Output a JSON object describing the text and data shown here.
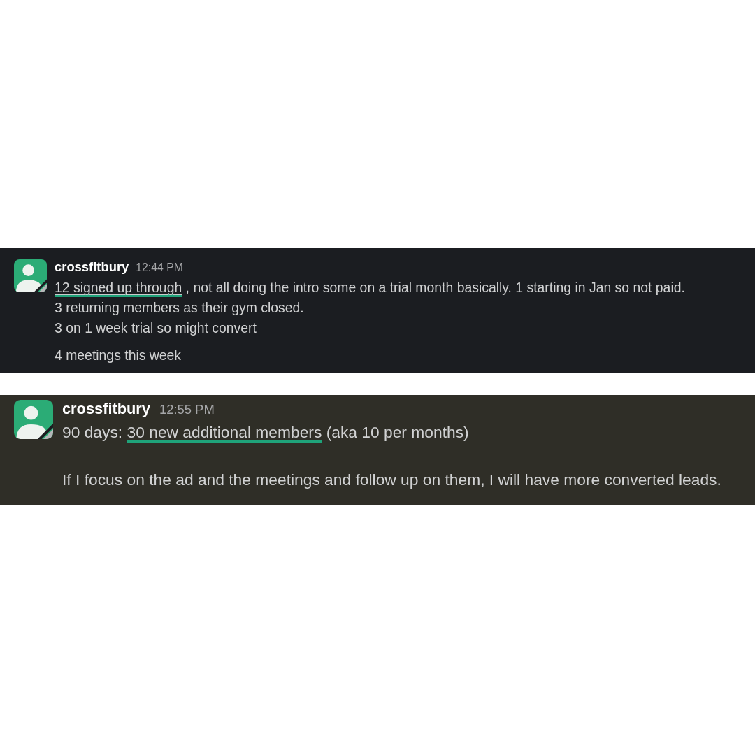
{
  "messages": [
    {
      "author": "crossfitbury",
      "time": "12:44 PM",
      "paragraphs": [
        [
          [
            {
              "text": "12 signed up through",
              "highlighted": true
            },
            {
              "text": " , not all doing the intro some on a trial month basically. 1 starting in Jan so not paid.",
              "highlighted": false
            }
          ],
          [
            {
              "text": "3 returning members as their gym closed.",
              "highlighted": false
            }
          ],
          [
            {
              "text": "3 on 1 week trial so might convert",
              "highlighted": false
            }
          ]
        ],
        [
          [
            {
              "text": "4 meetings this week",
              "highlighted": false
            }
          ]
        ]
      ]
    },
    {
      "author": "crossfitbury",
      "time": "12:55 PM",
      "paragraphs": [
        [
          [
            {
              "text": "90 days: ",
              "highlighted": false
            },
            {
              "text": "30 new additional members",
              "highlighted": true
            },
            {
              "text": " (aka 10 per months)",
              "highlighted": false
            }
          ]
        ],
        [
          [
            {
              "text": "If I focus on the ad and the meetings and follow up on them, I will have more converted leads.",
              "highlighted": false
            }
          ]
        ]
      ]
    }
  ]
}
